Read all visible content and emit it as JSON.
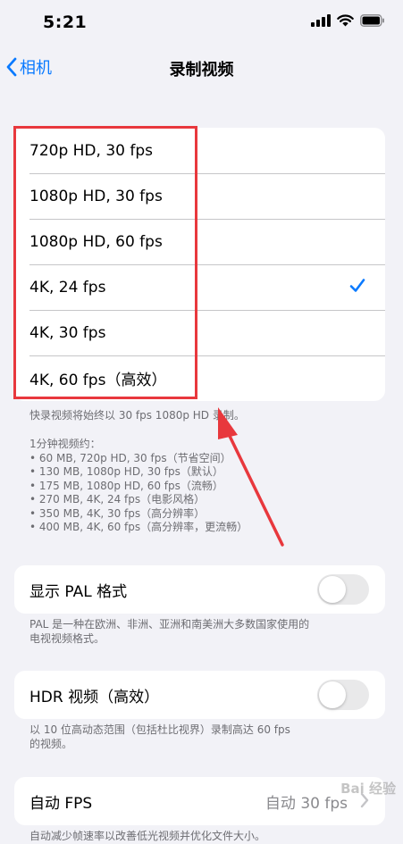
{
  "status_bar": {
    "time": "5:21"
  },
  "nav": {
    "back_label": "相机",
    "title": "录制视频"
  },
  "formats": {
    "options": [
      {
        "label": "720p HD, 30 fps"
      },
      {
        "label": "1080p HD, 30 fps"
      },
      {
        "label": "1080p HD, 60 fps"
      },
      {
        "label": "4K, 24 fps",
        "selected": true
      },
      {
        "label": "4K, 30 fps"
      },
      {
        "label": "4K, 60 fps（高效）"
      }
    ],
    "quick_note": "快录视频将始终以 30 fps 1080p HD 录制。",
    "size_heading": "1分钟视频约：",
    "sizes": [
      "• 60 MB, 720p HD, 30 fps（节省空间）",
      "• 130 MB, 1080p HD, 30 fps（默认）",
      "• 175 MB, 1080p HD, 60 fps（流畅）",
      "• 270 MB, 4K, 24 fps（电影风格）",
      "• 350 MB, 4K, 30 fps（高分辨率）",
      "• 400 MB, 4K, 60 fps（高分辨率，更流畅）"
    ]
  },
  "pal": {
    "label": "显示 PAL 格式",
    "enabled": false,
    "note_lines": [
      "PAL 是一种在欧洲、非洲、亚洲和南美洲大多数国家使用的",
      "电视视频格式。"
    ]
  },
  "hdr": {
    "label": "HDR 视频（高效）",
    "enabled": false,
    "note_lines": [
      "以 10 位高动态范围（包括杜比视界）录制高达 60 fps",
      "的视频。"
    ]
  },
  "auto_fps": {
    "label": "自动 FPS",
    "value": "自动 30 fps",
    "note": "自动减少帧速率以改善低光视频并优化文件大小。"
  },
  "colors": {
    "accent": "#0a7aff",
    "annotation": "#e8383d"
  },
  "watermark": "Bai 经验"
}
